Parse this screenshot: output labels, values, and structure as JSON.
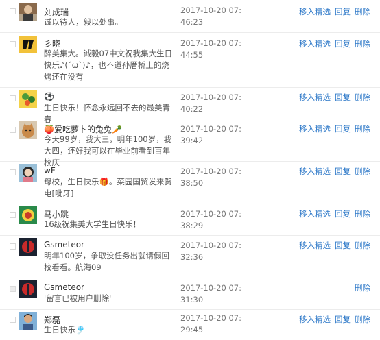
{
  "actions": {
    "feature": "移入精选",
    "reply": "回复",
    "delete": "删除"
  },
  "comments": [
    {
      "name": "刘成瑞",
      "message": "诚以待人，毅以处事。",
      "time": "2017-10-20 07:46:23",
      "avatar": "person-avatar"
    },
    {
      "name": "彡晓",
      "message": "醉美集大。诚毅07中文祝我集大生日快乐♪(´ω`)♪，也不道孙厝桥上的烧烤还在没有",
      "time": "2017-10-20 07:44:55",
      "avatar": "logo-avatar"
    },
    {
      "name": "⚽",
      "message": "生日快乐！怀念永远回不去的最美青春",
      "time": "2017-10-20 07:40:22",
      "avatar": "cartoon-avatar"
    },
    {
      "name": "🍑爱吃萝卜的兔兔🥕",
      "message": "今天99岁，我大三，明年100岁，我大四，还好我可以在毕业前看到百年校庆",
      "time": "2017-10-20 07:39:42",
      "avatar": "cat-avatar"
    },
    {
      "name": "wF",
      "message": "母校，生日快乐🎁。菜园国贸发来贺电[呲牙]",
      "time": "2017-10-20 07:38:50",
      "avatar": "girl-avatar"
    },
    {
      "name": "马小跳",
      "message": "16级祝集美大学生日快乐！",
      "time": "2017-10-20 07:38:29",
      "avatar": "emblem-avatar"
    },
    {
      "name": "Gsmeteor",
      "message": "明年100岁，争取没任务出就请假回校看看。航海09",
      "time": "2017-10-20 07:32:36",
      "avatar": "dark-avatar"
    },
    {
      "name": "Gsmeteor",
      "message": "'留言已被用户删除'",
      "time": "2017-10-20 07:31:30",
      "avatar": "dark-avatar"
    },
    {
      "name": "郑磊",
      "message": "生日快乐🎐",
      "time": "2017-10-20 07:29:45",
      "avatar": "man-avatar"
    }
  ]
}
